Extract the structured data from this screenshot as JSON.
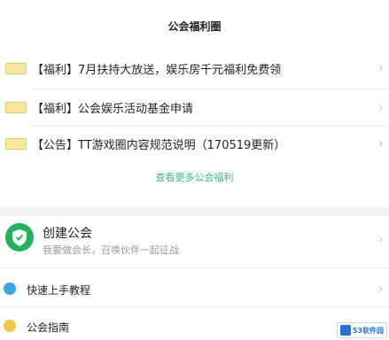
{
  "section1": {
    "title": "公会福利圈",
    "posts": [
      {
        "text": "【福利】7月扶持大放送，娱乐房千元福利免费领"
      },
      {
        "text": "【福利】公会娱乐活动基金申请"
      },
      {
        "text": "【公告】TT游戏圈内容规范说明（170519更新）"
      }
    ],
    "more_label": "查看更多公会福利"
  },
  "section2": {
    "create_title": "创建公会",
    "create_subtitle": "我要做会长，召唤伙伴一起征战",
    "items": [
      {
        "label": "快速上手教程"
      },
      {
        "label": "公会指南"
      }
    ]
  },
  "watermark": {
    "text": "53软件园"
  },
  "colors": {
    "accent_green": "#3dbb74",
    "badge_yellow": "#f7e7a0",
    "shield_green": "#22b25e"
  }
}
